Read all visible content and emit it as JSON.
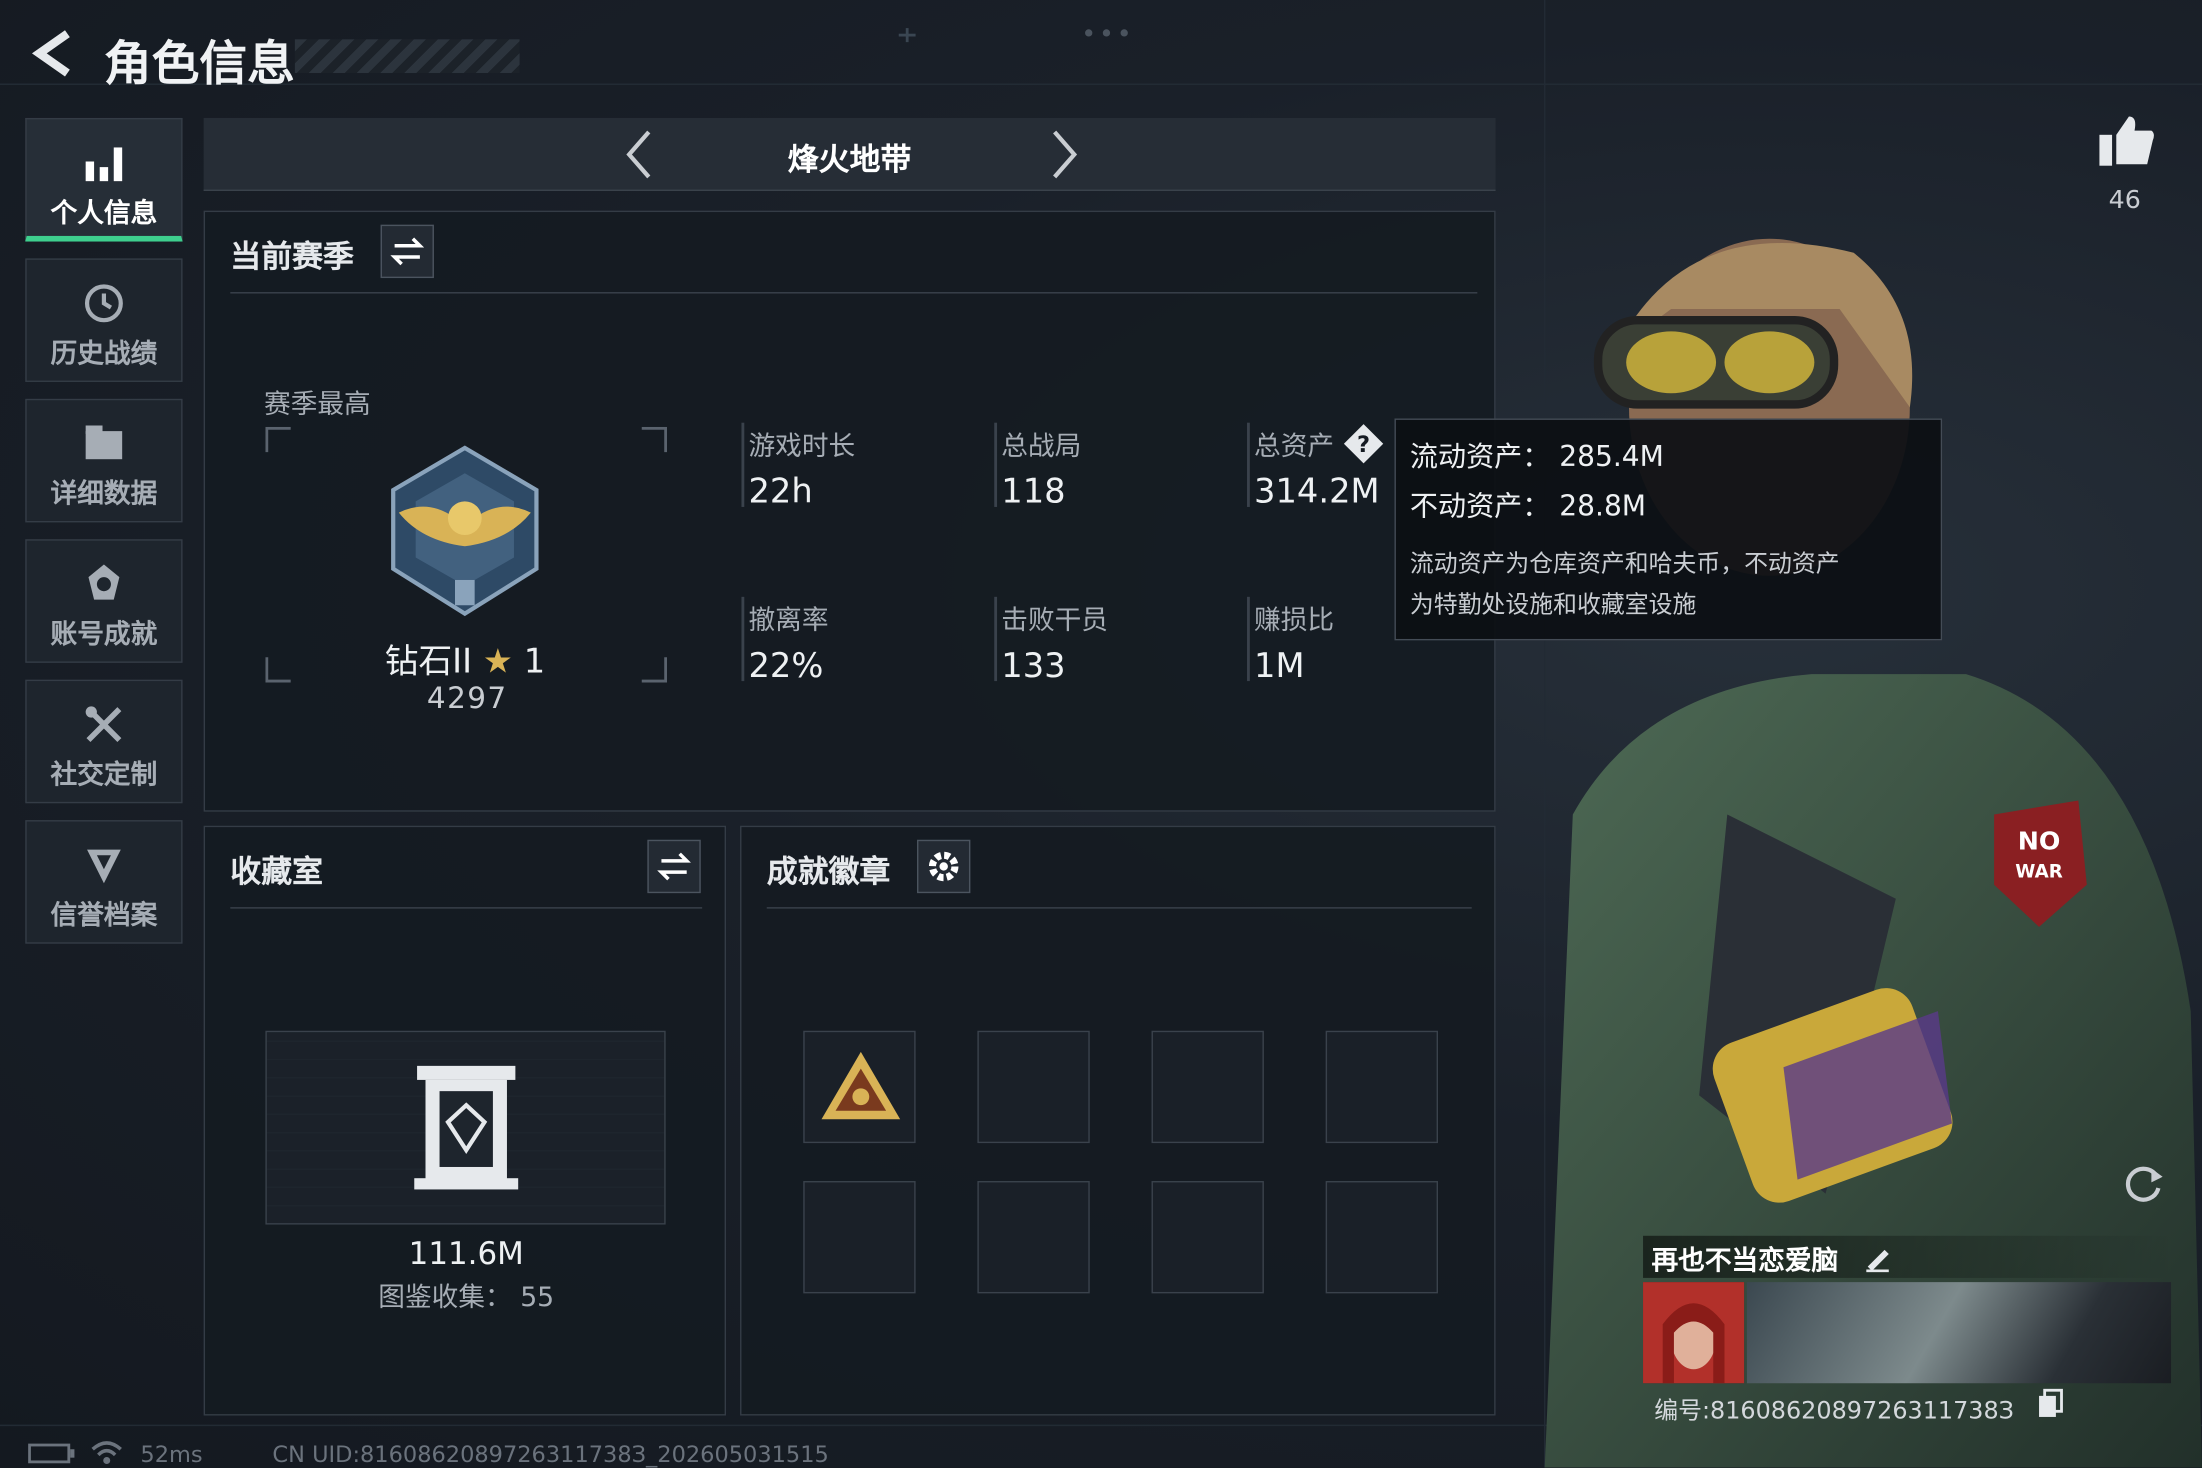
{
  "header": {
    "title": "角色信息"
  },
  "sidebar": {
    "items": [
      {
        "label": "个人信息",
        "icon": "bar-chart-icon",
        "active": true
      },
      {
        "label": "历史战绩",
        "icon": "history-icon"
      },
      {
        "label": "详细数据",
        "icon": "folder-icon"
      },
      {
        "label": "账号成就",
        "icon": "achievement-icon"
      },
      {
        "label": "社交定制",
        "icon": "tools-icon"
      },
      {
        "label": "信誉档案",
        "icon": "shield-icon"
      }
    ]
  },
  "mode": {
    "title": "烽火地带"
  },
  "season": {
    "section_title": "当前赛季",
    "best_label": "赛季最高",
    "rank_name": "钻石II",
    "rank_stars": "1",
    "rank_score": "4297",
    "stats": [
      {
        "label": "游戏时长",
        "value": "22h"
      },
      {
        "label": "总战局",
        "value": "118"
      },
      {
        "label": "总资产",
        "value": "314.2M"
      },
      {
        "label": "撤离率",
        "value": "22%"
      },
      {
        "label": "击败干员",
        "value": "133"
      },
      {
        "label": "赚损比",
        "value": "1M"
      }
    ]
  },
  "tooltip": {
    "liquid": "流动资产：  285.4M",
    "fixed": "不动资产：  28.8M",
    "desc1": "流动资产为仓库资产和哈夫币，不动资产",
    "desc2": "为特勤处设施和收藏室设施"
  },
  "collection": {
    "title": "收藏室",
    "value": "111.6M",
    "count": "图鉴收集：  55"
  },
  "badges": {
    "title": "成就徽章"
  },
  "profile": {
    "likes": "46",
    "name": "再也不当恋爱脑",
    "id": "编号:8160862089726311738З"
  },
  "status": {
    "ping": "52ms",
    "uid": "CN UID:8160862089726311738З_202605031515"
  },
  "colors": {
    "accent": "#3ecf8e",
    "panel": "#151b22",
    "gold": "#d9b356"
  }
}
